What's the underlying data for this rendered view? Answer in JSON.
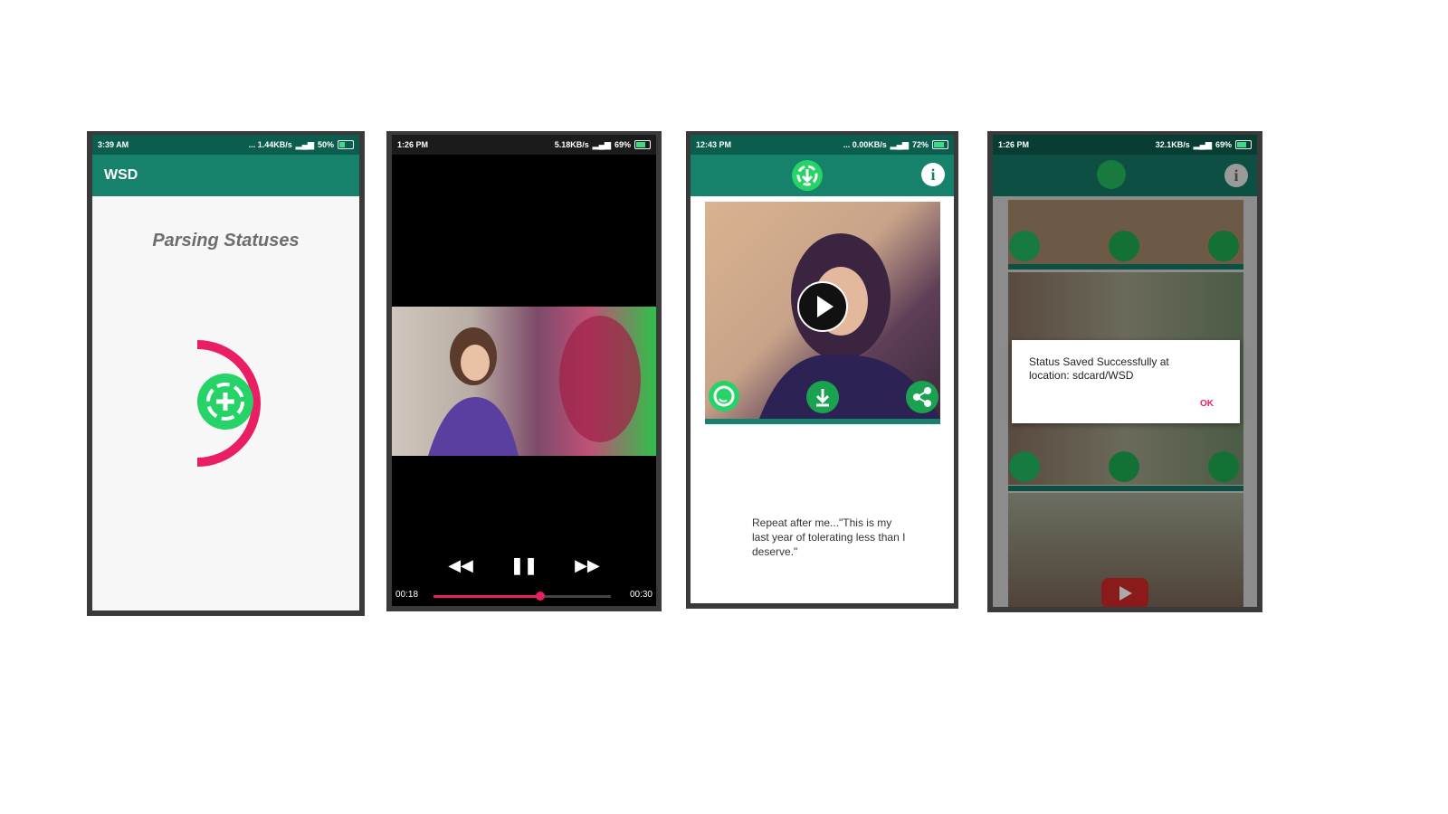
{
  "phone1": {
    "status": {
      "time": "3:39 AM",
      "net": "... 1.44KB/s",
      "battery": "50%"
    },
    "app_title": "WSD",
    "heading": "Parsing Statuses",
    "colors": {
      "accent": "#e91e63",
      "bar": "#16826b"
    }
  },
  "phone2": {
    "status": {
      "time": "1:26 PM",
      "net": "5.18KB/s",
      "battery": "69%"
    },
    "elapsed": "00:18",
    "duration": "00:30",
    "progress": 0.6,
    "icons": [
      "rewind-icon",
      "pause-icon",
      "fast-forward-icon"
    ]
  },
  "phone3": {
    "status": {
      "time": "12:43 PM",
      "net": "... 0.00KB/s",
      "battery": "72%"
    },
    "quote": "Repeat after me...\"This is my last year of tolerating less than I deserve.\"",
    "icons": [
      "download-logo-icon",
      "info-icon",
      "play-icon",
      "whatsapp-icon",
      "download-icon",
      "share-icon"
    ]
  },
  "phone4": {
    "status": {
      "time": "1:26 PM",
      "net": "32.1KB/s",
      "battery": "69%"
    },
    "dialog": {
      "message": "Status Saved Successfully at location: sdcard/WSD",
      "ok_label": "OK"
    }
  }
}
